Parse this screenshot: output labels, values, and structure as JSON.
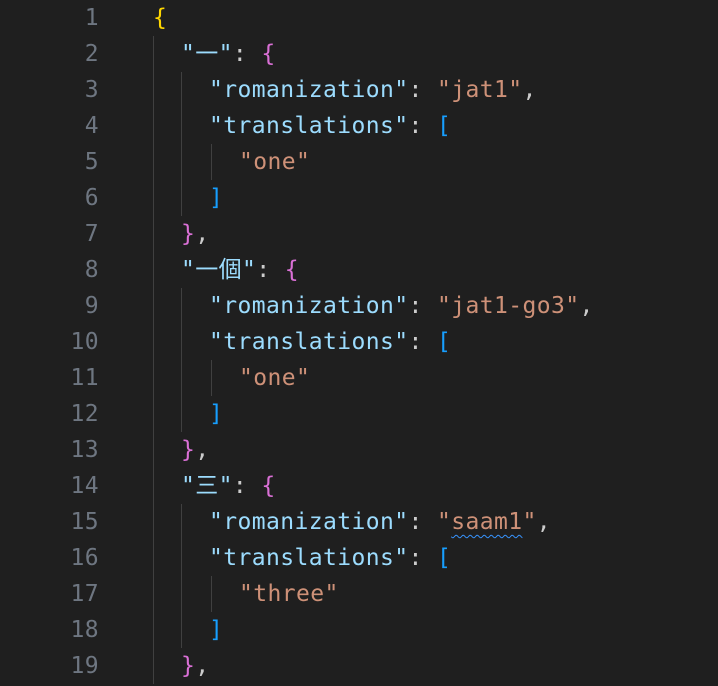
{
  "editor": {
    "lines": [
      {
        "n": "1",
        "indent": 0,
        "key": "",
        "sep": "",
        "value": "",
        "bracket": "{",
        "bracket_color": "b1",
        "tail": ""
      },
      {
        "n": "2",
        "indent": 1,
        "key": "\"一\"",
        "sep": ": ",
        "value": "",
        "bracket": "{",
        "bracket_color": "b2",
        "tail": ""
      },
      {
        "n": "3",
        "indent": 2,
        "key": "\"romanization\"",
        "sep": ": ",
        "value": "\"jat1\"",
        "bracket": "",
        "bracket_color": "",
        "tail": ","
      },
      {
        "n": "4",
        "indent": 2,
        "key": "\"translations\"",
        "sep": ": ",
        "value": "",
        "bracket": "[",
        "bracket_color": "b3",
        "tail": ""
      },
      {
        "n": "5",
        "indent": 3,
        "key": "",
        "sep": "",
        "value": "\"one\"",
        "bracket": "",
        "bracket_color": "",
        "tail": ""
      },
      {
        "n": "6",
        "indent": 2,
        "key": "",
        "sep": "",
        "value": "",
        "bracket": "]",
        "bracket_color": "b3",
        "tail": ""
      },
      {
        "n": "7",
        "indent": 1,
        "key": "",
        "sep": "",
        "value": "",
        "bracket": "}",
        "bracket_color": "b2",
        "tail": ","
      },
      {
        "n": "8",
        "indent": 1,
        "key": "\"一個\"",
        "sep": ": ",
        "value": "",
        "bracket": "{",
        "bracket_color": "b2",
        "tail": ""
      },
      {
        "n": "9",
        "indent": 2,
        "key": "\"romanization\"",
        "sep": ": ",
        "value": "\"jat1-go3\"",
        "bracket": "",
        "bracket_color": "",
        "tail": ","
      },
      {
        "n": "10",
        "indent": 2,
        "key": "\"translations\"",
        "sep": ": ",
        "value": "",
        "bracket": "[",
        "bracket_color": "b3",
        "tail": ""
      },
      {
        "n": "11",
        "indent": 3,
        "key": "",
        "sep": "",
        "value": "\"one\"",
        "bracket": "",
        "bracket_color": "",
        "tail": ""
      },
      {
        "n": "12",
        "indent": 2,
        "key": "",
        "sep": "",
        "value": "",
        "bracket": "]",
        "bracket_color": "b3",
        "tail": ""
      },
      {
        "n": "13",
        "indent": 1,
        "key": "",
        "sep": "",
        "value": "",
        "bracket": "}",
        "bracket_color": "b2",
        "tail": ","
      },
      {
        "n": "14",
        "indent": 1,
        "key": "\"三\"",
        "sep": ": ",
        "value": "",
        "bracket": "{",
        "bracket_color": "b2",
        "tail": ""
      },
      {
        "n": "15",
        "indent": 2,
        "key": "\"romanization\"",
        "sep": ": ",
        "value": "\"saam1\"",
        "bracket": "",
        "bracket_color": "",
        "tail": ",",
        "squiggle": "saam1"
      },
      {
        "n": "16",
        "indent": 2,
        "key": "\"translations\"",
        "sep": ": ",
        "value": "",
        "bracket": "[",
        "bracket_color": "b3",
        "tail": ""
      },
      {
        "n": "17",
        "indent": 3,
        "key": "",
        "sep": "",
        "value": "\"three\"",
        "bracket": "",
        "bracket_color": "",
        "tail": ""
      },
      {
        "n": "18",
        "indent": 2,
        "key": "",
        "sep": "",
        "value": "",
        "bracket": "]",
        "bracket_color": "b3",
        "tail": ""
      },
      {
        "n": "19",
        "indent": 1,
        "key": "",
        "sep": "",
        "value": "",
        "bracket": "}",
        "bracket_color": "b2",
        "tail": ","
      }
    ]
  },
  "colors": {
    "background": "#1f1f1f",
    "line_number": "#6e7681",
    "key": "#9cdcfe",
    "string": "#ce9178",
    "bracket_depth_1": "#ffd700",
    "bracket_depth_2": "#da70d6",
    "bracket_depth_3": "#179fff",
    "spelling_squiggle": "#3794ff"
  }
}
